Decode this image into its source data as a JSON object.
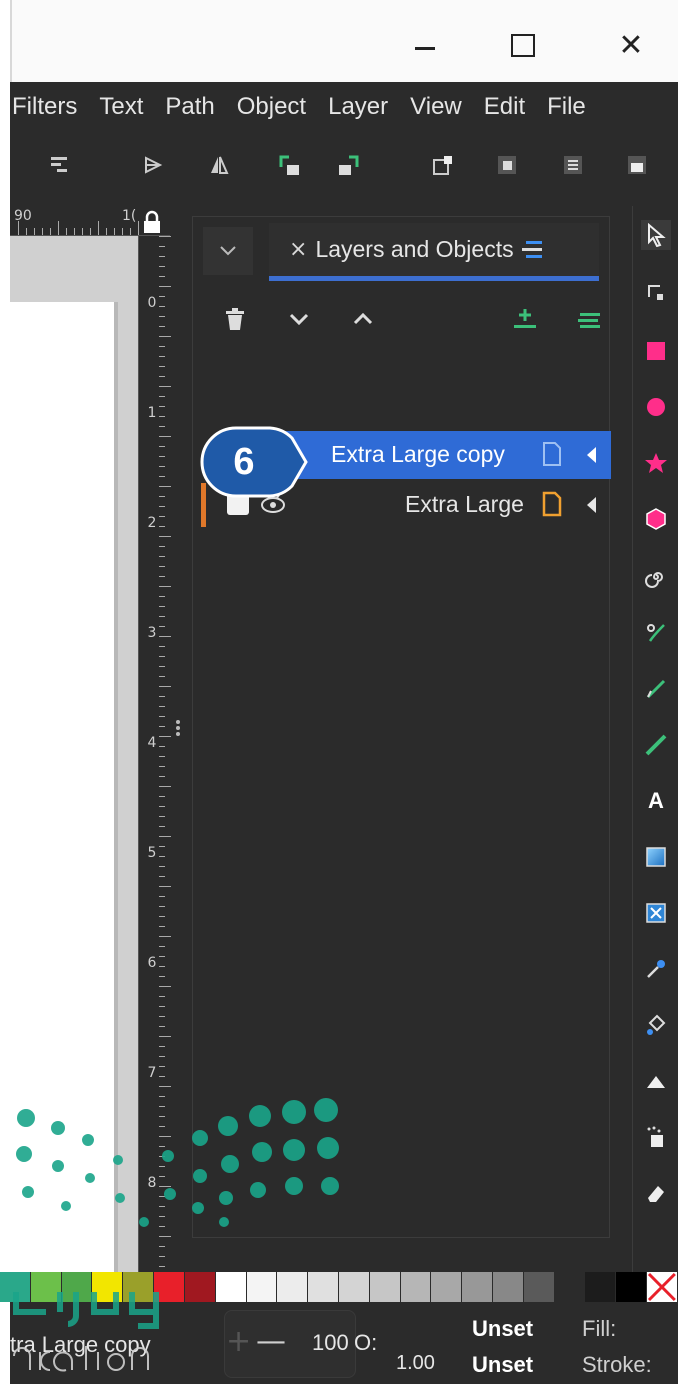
{
  "window": {
    "minimize_glyph": "",
    "maximize_glyph": "",
    "close_glyph": "✕"
  },
  "menubar": {
    "items": [
      "Filters",
      "Text",
      "Path",
      "Object",
      "Layer",
      "View",
      "Edit",
      "File"
    ]
  },
  "ruler": {
    "top_labels": [
      "90",
      "1("
    ],
    "left_labels": [
      "0",
      "1",
      "2",
      "3",
      "4",
      "5",
      "6",
      "7",
      "8"
    ]
  },
  "dock": {
    "tab_close_glyph": "×",
    "tab_label": "Layers and Objects",
    "rows": [
      {
        "label": "Extra Large copy",
        "selected": true
      },
      {
        "label": "Extra Large",
        "selected": false
      }
    ]
  },
  "callout": {
    "number": "6"
  },
  "palette": {
    "colors": [
      "#2aa88a",
      "#6cc04a",
      "#4fa84a",
      "#f2e600",
      "#9aa02a",
      "#e8202a",
      "#a01820",
      "#ffffff",
      "#f4f4f4",
      "#ececec",
      "#e0e0e0",
      "#d4d4d4",
      "#c6c6c6",
      "#b6b6b6",
      "#a8a8a8",
      "#989898",
      "#888888",
      "#5a5a5a",
      "#2b2b2b",
      "#1c1c1c",
      "#000000",
      "#ffffff"
    ]
  },
  "status": {
    "current_layer": "tra Large copy",
    "opacity_value": "100",
    "opacity_label": "O:",
    "stroke_width": "1.00",
    "fill_value": "Unset",
    "stroke_value": "Unset",
    "fill_label": "Fill:",
    "stroke_label": "Stroke:"
  },
  "colors": {
    "accent": "#2f6bd6",
    "callout": "#1f5aa8",
    "layer_accent": "#e0782a",
    "watermark": "#1aa58a"
  },
  "icons": {
    "toolbar": [
      "align-icon",
      "flip-horizontal-icon",
      "flip-vertical-icon",
      "rotate-ccw-icon",
      "rotate-cw-icon",
      "raise-icon",
      "lower-icon",
      "xml-editor-icon",
      "object-properties-icon"
    ],
    "toolbox": [
      "selector-icon",
      "node-icon",
      "rectangle-icon",
      "ellipse-icon",
      "star-icon",
      "3d-box-icon",
      "spiral-icon",
      "pen-icon",
      "pencil-icon",
      "calligraphy-icon",
      "text-icon",
      "gradient-icon",
      "mesh-icon",
      "dropper-icon",
      "paint-bucket-icon",
      "tweak-icon",
      "spray-icon",
      "eraser-icon"
    ]
  }
}
